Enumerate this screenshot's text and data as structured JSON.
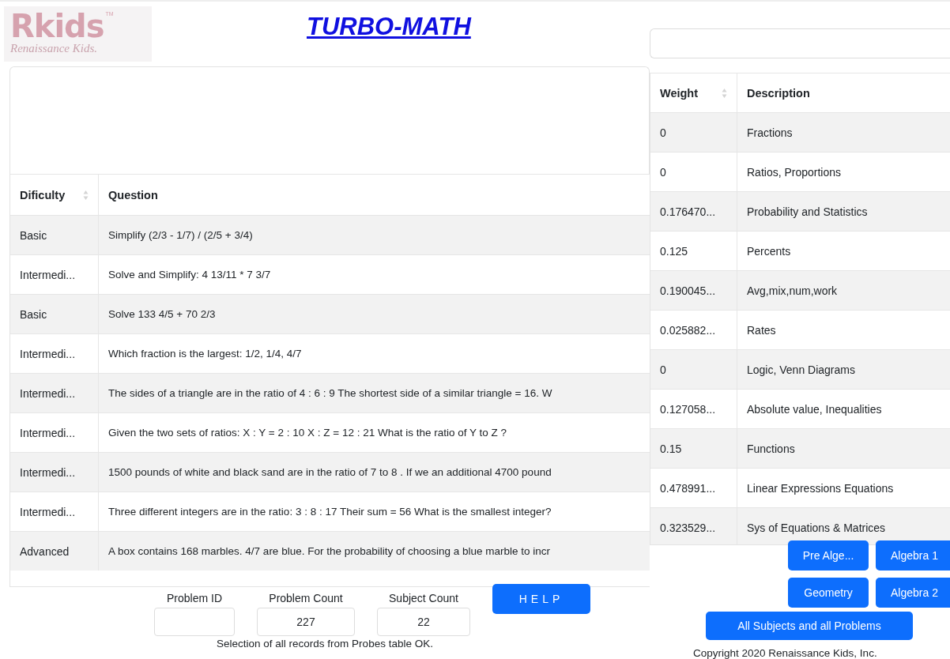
{
  "logo": {
    "mark": "Rkids",
    "trademark": "TM",
    "tagline": "Renaissance Kids."
  },
  "title": "TURBO-MATH",
  "question_table": {
    "columns": [
      "Dificulty",
      "Question"
    ],
    "rows": [
      {
        "difficulty": "Basic",
        "question": "Simplify (2/3 - 1/7) / (2/5 + 3/4)"
      },
      {
        "difficulty": "Intermedi...",
        "question": "Solve and Simplify: 4 13/11 * 7 3/7"
      },
      {
        "difficulty": "Basic",
        "question": "Solve 133 4/5 + 70 2/3"
      },
      {
        "difficulty": "Intermedi...",
        "question": "Which fraction is the largest: 1/2, 1/4, 4/7"
      },
      {
        "difficulty": "Intermedi...",
        "question": "The sides of a triangle are in the ratio of 4 : 6 : 9 The shortest side of a similar triangle = 16. W"
      },
      {
        "difficulty": "Intermedi...",
        "question": "Given the two sets of ratios: X : Y = 2 : 10 X : Z = 12 : 21 What is the ratio of Y to Z ?"
      },
      {
        "difficulty": "Intermedi...",
        "question": "1500 pounds of white and black sand are in the ratio of 7 to 8 . If we an additional 4700 pound"
      },
      {
        "difficulty": "Intermedi...",
        "question": "Three different integers are in the ratio: 3 : 8 : 17 Their sum = 56 What is the smallest integer?"
      },
      {
        "difficulty": "Advanced",
        "question": "A box contains 168 marbles. 4/7 are blue. For the probability of choosing a blue marble to incr"
      }
    ]
  },
  "fields": [
    {
      "label": "Problem ID"
    },
    {
      "label": "Problem Count",
      "value": "227"
    },
    {
      "label": "Subject Count",
      "value": "22"
    }
  ],
  "help_button": "HELP",
  "status": "Selection of all records from Probes table OK.",
  "subject_table": {
    "columns": [
      "Weight",
      "Description"
    ],
    "rows": [
      {
        "weight": "0",
        "description": "Fractions"
      },
      {
        "weight": "0",
        "description": "Ratios, Proportions"
      },
      {
        "weight": "0.176470...",
        "description": "Probability and Statistics"
      },
      {
        "weight": "0.125",
        "description": "Percents"
      },
      {
        "weight": "0.190045...",
        "description": "Avg,mix,num,work"
      },
      {
        "weight": "0.025882...",
        "description": "Rates"
      },
      {
        "weight": "0",
        "description": "Logic, Venn Diagrams"
      },
      {
        "weight": "0.127058...",
        "description": "Absolute value, Inequalities"
      },
      {
        "weight": "0.15",
        "description": "Functions"
      },
      {
        "weight": "0.478991...",
        "description": "Linear Expressions Equations"
      },
      {
        "weight": "0.323529...",
        "description": "Sys of Equations & Matrices"
      }
    ]
  },
  "subject_buttons": [
    "Pre Alge...",
    "Algebra 1",
    "Geometry",
    "Algebra 2"
  ],
  "all_button": "All Subjects and all Problems",
  "copyright": "Copyright 2020 Renaissance Kids, Inc."
}
